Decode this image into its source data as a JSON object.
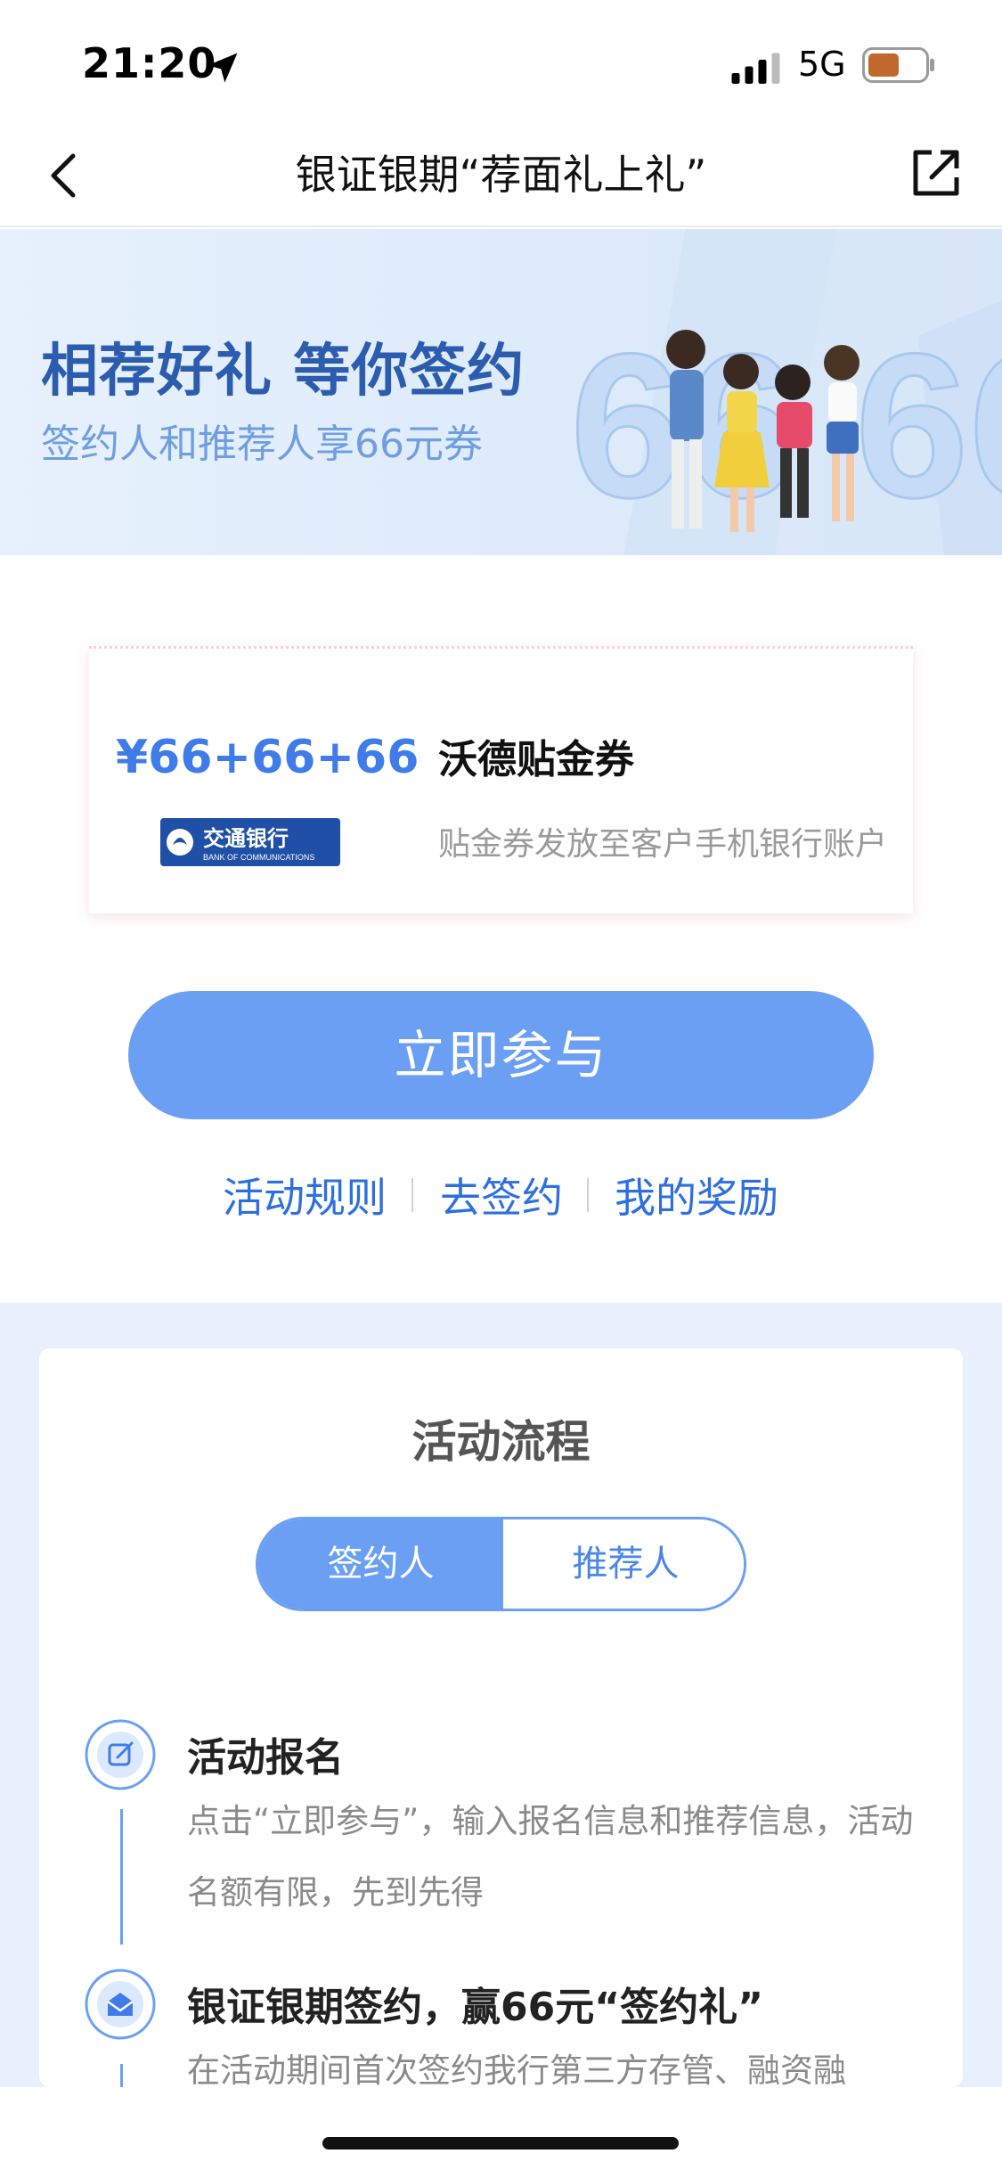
{
  "status_bar": {
    "time": "21:20",
    "network": "5G",
    "battery_color": "#c1692c"
  },
  "nav": {
    "title": "银证银期“荐面礼上礼”",
    "back_icon": "chevron-left-icon",
    "share_icon": "share-icon"
  },
  "banner": {
    "title": "相荐好礼 等你签约",
    "subtitle": "签约人和推荐人享66元券",
    "big_number": "66 66"
  },
  "coupon": {
    "amount": "¥66+66+66",
    "name": "沃德贴金券",
    "description": "贴金券发放至客户手机银行账户",
    "bank_name": "交通银行",
    "bank_name_en": "BANK OF COMMUNICATIONS"
  },
  "join_button": {
    "label": "立即参与",
    "color": "#6a9ff4"
  },
  "links": [
    {
      "label": "活动规则"
    },
    {
      "label": "去签约"
    },
    {
      "label": "我的奖励"
    }
  ],
  "process": {
    "title": "活动流程",
    "tabs": [
      {
        "label": "签约人",
        "active": true
      },
      {
        "label": "推荐人",
        "active": false
      }
    ],
    "steps": [
      {
        "icon": "edit-icon",
        "title": "活动报名",
        "description": "点击“立即参与”，输入报名信息和推荐信息，活动名额有限，先到先得"
      },
      {
        "icon": "envelope-icon",
        "title": "银证银期签约，赢66元“签约礼”",
        "description": "在活动期间首次签约我行第三方存管、融资融"
      }
    ]
  }
}
